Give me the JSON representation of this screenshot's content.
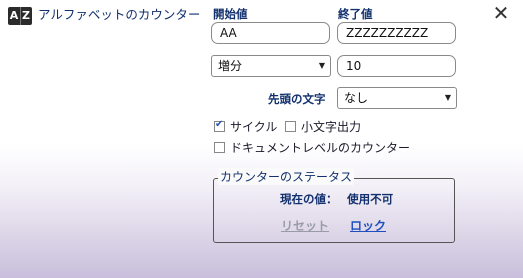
{
  "header": {
    "app_icon_left": "A",
    "app_icon_right": "Z",
    "title": "アルファベットのカウンター"
  },
  "start": {
    "label": "開始値",
    "value": "AA"
  },
  "end": {
    "label": "終了値",
    "value": "ZZZZZZZZZZ"
  },
  "step": {
    "mode": "増分",
    "value": "10"
  },
  "prefix": {
    "label": "先頭の文字",
    "value": "なし"
  },
  "options": {
    "cycle_label": "サイクル",
    "cycle_checked": true,
    "lowercase_label": "小文字出力",
    "lowercase_checked": false,
    "doc_level_label": "ドキュメントレベルのカウンター",
    "doc_level_checked": false
  },
  "status": {
    "group_title": "カウンターのステータス",
    "current_label": "現在の値：",
    "current_value": "使用不可",
    "reset_label": "リセット",
    "lock_label": "ロック"
  },
  "icons": {
    "close": "close-icon",
    "app": "az-counter-icon",
    "caret": "chevron-down-icon"
  }
}
